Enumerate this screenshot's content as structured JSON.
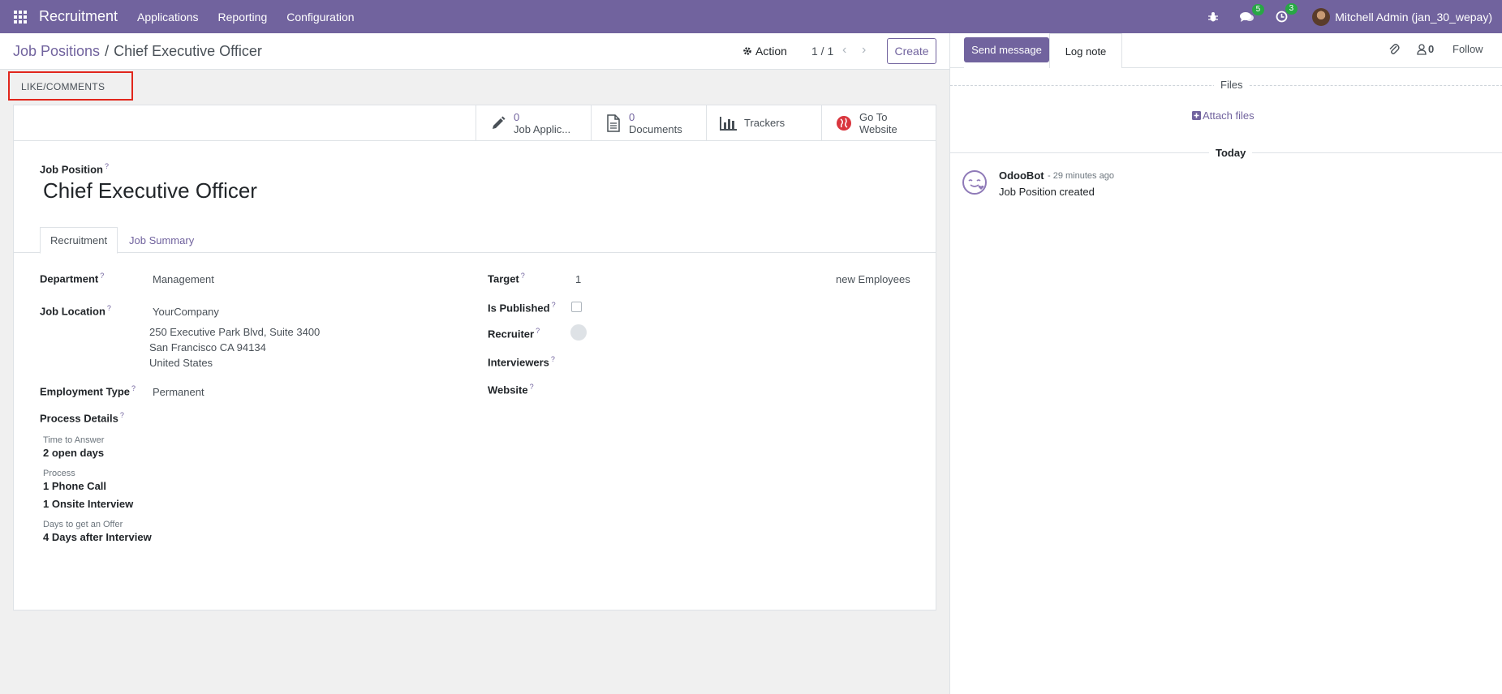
{
  "navbar": {
    "brand": "Recruitment",
    "menu": [
      "Applications",
      "Reporting",
      "Configuration"
    ],
    "messages_count": "5",
    "activities_count": "3",
    "user": "Mitchell Admin (jan_30_wepay)"
  },
  "control_panel": {
    "breadcrumb_parent": "Job Positions",
    "breadcrumb_separator": "/",
    "breadcrumb_current": "Chief Executive Officer",
    "action_label": "Action",
    "pager": "1 / 1",
    "create_label": "Create"
  },
  "like_comments": "LIKE/COMMENTS",
  "smart_buttons": {
    "applications": {
      "count": "0",
      "label": "Job Applic..."
    },
    "documents": {
      "count": "0",
      "label": "Documents"
    },
    "trackers": {
      "label": "Trackers"
    },
    "website": {
      "line1": "Go To",
      "line2": "Website"
    }
  },
  "form": {
    "job_position_label": "Job Position",
    "job_position": "Chief Executive Officer",
    "help_mark": "?",
    "tabs": [
      "Recruitment",
      "Job Summary"
    ],
    "department_label": "Department",
    "department": "Management",
    "job_location_label": "Job Location",
    "job_location": "YourCompany",
    "address_line1": "250 Executive Park Blvd, Suite 3400",
    "address_line2": "San Francisco CA 94134",
    "address_line3": "United States",
    "employment_type_label": "Employment Type",
    "employment_type": "Permanent",
    "process_details_label": "Process Details",
    "time_to_answer_label": "Time to Answer",
    "time_to_answer": "2 open days",
    "process_label": "Process",
    "process_step1": "1 Phone Call",
    "process_step2": "1 Onsite Interview",
    "days_offer_label": "Days to get an Offer",
    "days_offer": "4 Days after Interview",
    "target_label": "Target",
    "target": "1",
    "target_suffix": "new Employees",
    "is_published_label": "Is Published",
    "recruiter_label": "Recruiter",
    "interviewers_label": "Interviewers",
    "website_label": "Website"
  },
  "chatter": {
    "send_message": "Send message",
    "log_note": "Log note",
    "followers_count": "0",
    "follow": "Follow",
    "files": "Files",
    "attach_files": "Attach files",
    "today": "Today",
    "message": {
      "author": "OdooBot",
      "time": "- 29 minutes ago",
      "body": "Job Position created"
    }
  }
}
